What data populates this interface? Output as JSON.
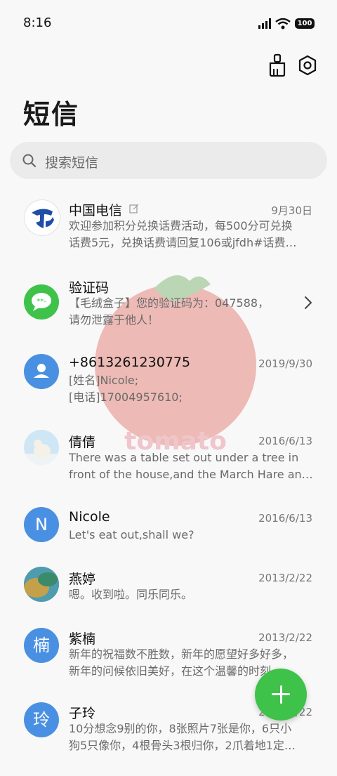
{
  "status": {
    "time": "8:16",
    "battery": "100"
  },
  "header": {
    "title": "短信",
    "search_placeholder": "搜索短信"
  },
  "conversations": [
    {
      "name": "中国电信",
      "date": "9月30日",
      "lines": [
        "欢迎参加积分兑换话费活动，每500分可兑换",
        "话费5元，兑换话费请回复106或jfdh#话费…"
      ]
    },
    {
      "name": "验证码",
      "date": "",
      "lines": [
        "【毛绒盒子】您的验证码为：047588，",
        "请勿泄露于他人！"
      ]
    },
    {
      "name": "+8613261230775",
      "date": "2019/9/30",
      "lines": [
        "[姓名]Nicole;",
        "[电话]17004957610;"
      ]
    },
    {
      "name": "倩倩",
      "date": "2016/6/13",
      "lines": [
        "There was a table set out under a tree in",
        "front of the house,and the March Hare an…"
      ]
    },
    {
      "name": "Nicole",
      "date": "2016/6/13",
      "avatar_letter": "N",
      "lines": [
        "Let's eat out,shall we?"
      ]
    },
    {
      "name": "燕婷",
      "date": "2013/2/22",
      "lines": [
        "嗯。收到啦。同乐同乐。"
      ]
    },
    {
      "name": "紫楠",
      "date": "2013/2/22",
      "avatar_letter": "楠",
      "lines": [
        "新年的祝福数不胜数，新年的愿望好多好多，",
        "新年的问候依旧美好，在这个温馨的时刻…"
      ]
    },
    {
      "name": "子玲",
      "date": "2013/2/22",
      "avatar_letter": "玲",
      "lines": [
        "10分想念9别的你，8张照片7张是你，6只小",
        "狗5只像你，4根骨头3根归你，2爪着地1定…"
      ]
    }
  ],
  "watermark_text": "tomato",
  "colors": {
    "accent_green": "#3ec24a",
    "avatar_blue": "#4a90e2",
    "verify_green": "#3ec24a"
  }
}
